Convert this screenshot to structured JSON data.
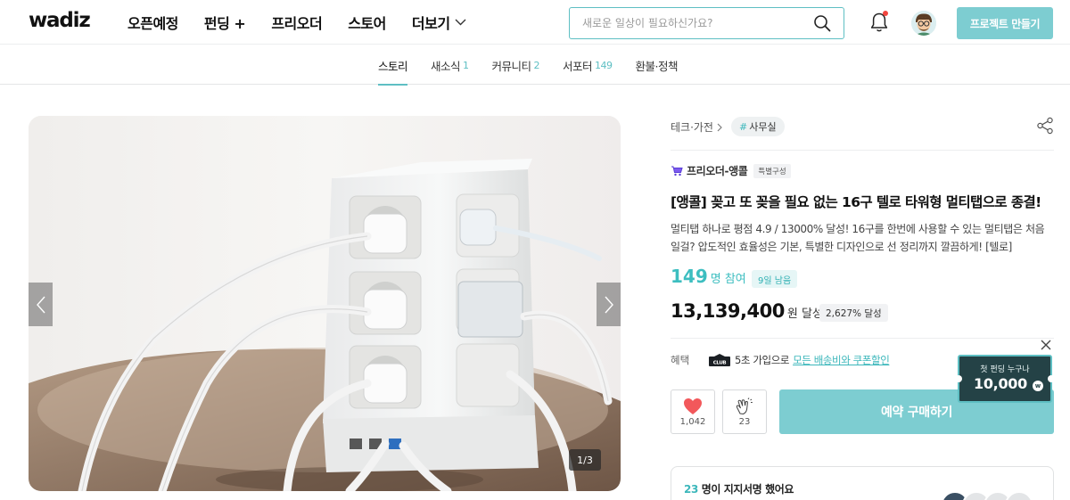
{
  "header": {
    "logo": "wadiz",
    "nav": [
      {
        "label": "오픈예정"
      },
      {
        "label": "펀딩 +"
      },
      {
        "label": "프리오더"
      },
      {
        "label": "스토어"
      },
      {
        "label": "더보기"
      }
    ],
    "search_placeholder": "새로운 일상이 필요하신가요?",
    "make_project": "프로젝트 만들기"
  },
  "tabs": [
    {
      "label": "스토리",
      "count": ""
    },
    {
      "label": "새소식",
      "count": "1"
    },
    {
      "label": "커뮤니티",
      "count": "2"
    },
    {
      "label": "서포터",
      "count": "149"
    },
    {
      "label": "환불·정책",
      "count": ""
    }
  ],
  "gallery": {
    "counter": "1/3",
    "icons": {
      "prev": "chevron-left-icon",
      "next": "chevron-right-icon"
    }
  },
  "product": {
    "category": "테크·가전",
    "hashtag_symbol": "#",
    "hashtag": "사무실",
    "maker": "프리오더-앵콜",
    "maker_badge": "특별구성",
    "title": "[앵콜] 꽂고 또 꽂을 필요 없는 16구 텔로 타워형 멀티탭으로 종결!",
    "description": "멀티탭 하나로 평점 4.9 / 13000% 달성! 16구를 한번에 사용할 수 있는 멀티탭은 처음일걸? 압도적인 효율성은 기본, 특별한 디자인으로 선 정리까지 깔끔하게! [텔로]",
    "supporters": "149",
    "supporters_unit": "명 참여",
    "days_left": "9일 남음",
    "amount": "13,139,400",
    "amount_unit": "원 달성",
    "achievement": "2,627% 달성",
    "benefit_label": "혜택",
    "benefit_prefix": "5초 가입으로",
    "benefit_link": "모든 배송비와 쿠폰할인",
    "likes": "1,042",
    "claps": "23",
    "buy_label": "예약 구매하기"
  },
  "promo": {
    "line1": "첫 펀딩 누구나",
    "amount": "10,000",
    "coin": "w"
  },
  "signature": {
    "count": "23",
    "text": "명이 지지서명 했어요"
  },
  "colors": {
    "accent": "#5ebfc3",
    "button": "#7dcdd1",
    "like": "#f2585b",
    "notification": "#f2463f"
  }
}
